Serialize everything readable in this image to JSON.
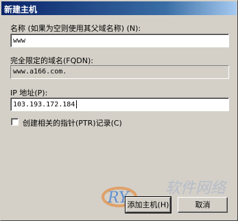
{
  "dialog": {
    "title": "新建主机",
    "name_label": "名称 (如果为空则使用其父域名称) (N):",
    "name_value": "www",
    "fqdn_label": "完全限定的域名(FQDN):",
    "fqdn_value": "www.a166.com.",
    "ip_label": "IP 地址(P):",
    "ip_value": "103.193.172.184",
    "ptr_label": "创建相关的指针(PTR)记录(C)",
    "ptr_checked": false,
    "add_button": "添加主机(H)",
    "cancel_button": "取消"
  },
  "watermark": {
    "logo_text": "RY",
    "brand_text": "软件网络"
  },
  "colors": {
    "face": "#d4d0c8",
    "title_start": "#0a246a",
    "title_end": "#a6caf0",
    "watermark_accent": "#e87a1e"
  }
}
